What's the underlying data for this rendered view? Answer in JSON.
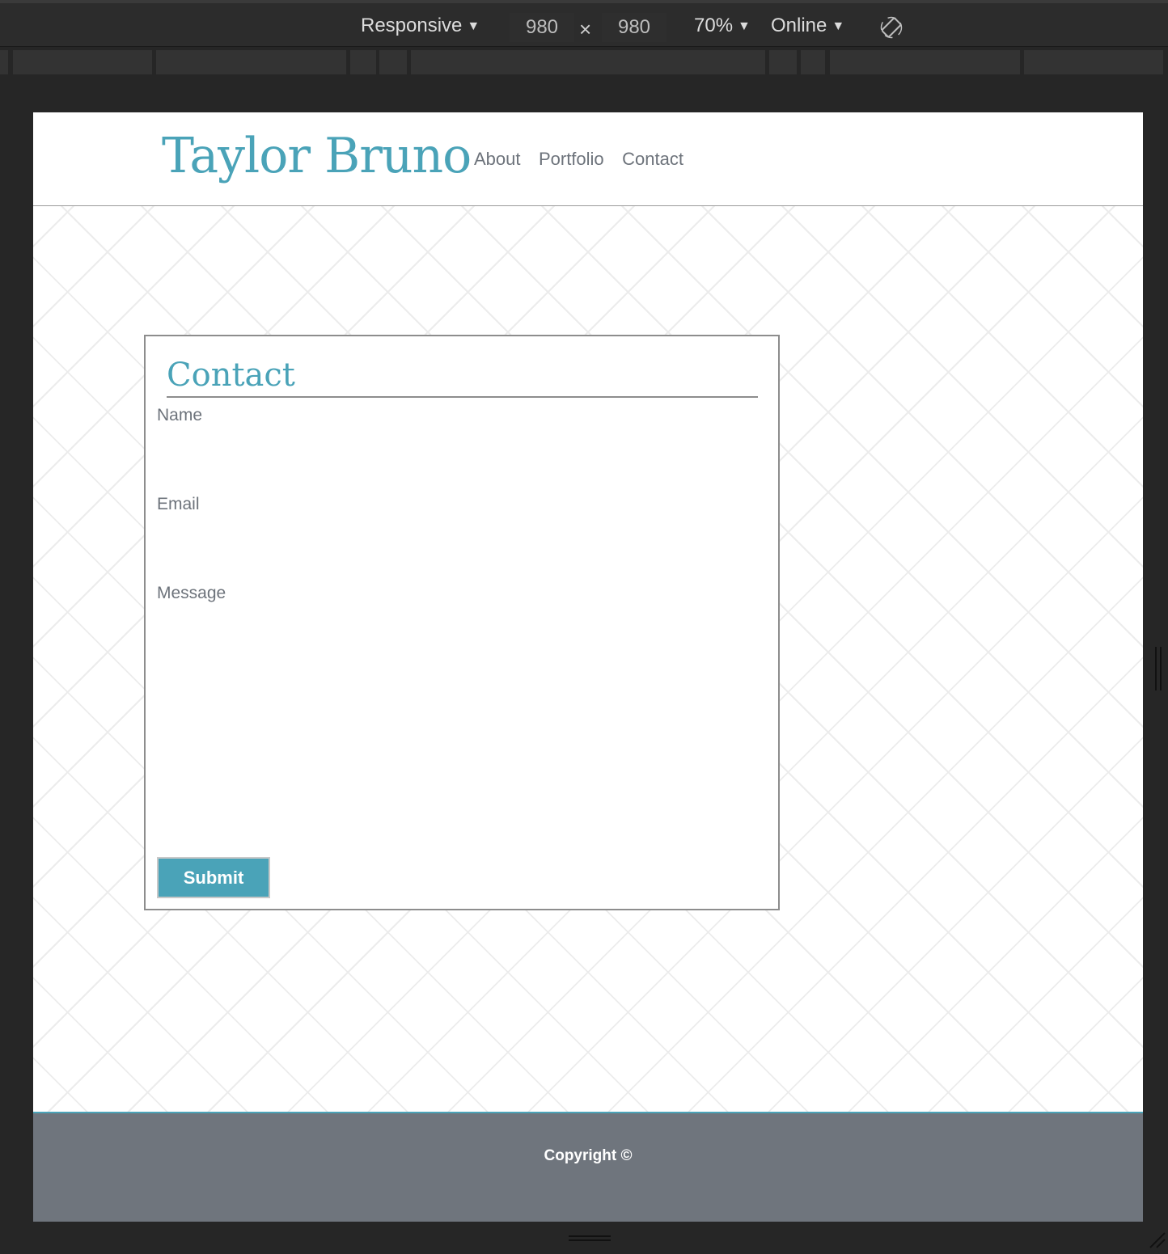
{
  "devtools": {
    "device_label": "Responsive",
    "width_value": "980",
    "times_symbol": "×",
    "height_value": "980",
    "zoom_label": "70%",
    "network_label": "Online",
    "caret": "▼"
  },
  "site": {
    "title": "Taylor Bruno",
    "nav": [
      "About",
      "Portfolio",
      "Contact"
    ]
  },
  "contact": {
    "heading": "Contact",
    "name_label": "Name",
    "email_label": "Email",
    "message_label": "Message",
    "submit_label": "Submit"
  },
  "footer": {
    "text": "Copyright ©"
  },
  "colors": {
    "accent": "#4aa3b8",
    "text": "#6d737b",
    "footer_bg": "#6f757d",
    "devtools_bg": "#262626"
  }
}
